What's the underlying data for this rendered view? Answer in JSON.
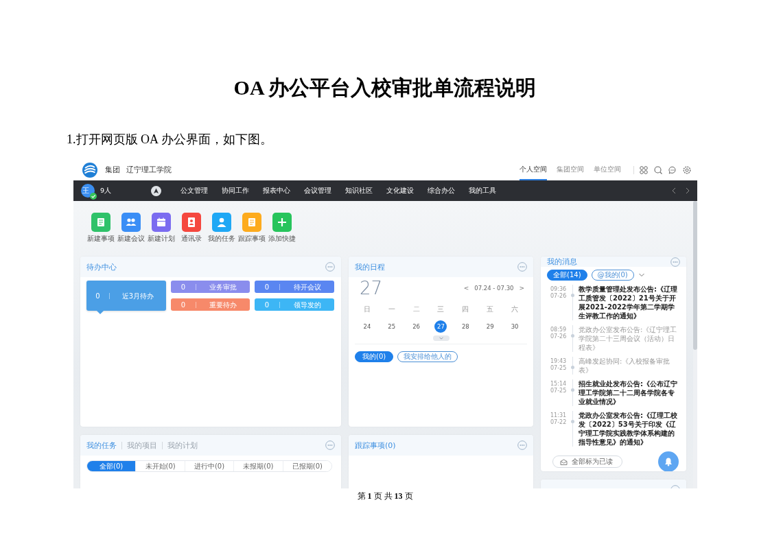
{
  "document": {
    "title": "OA 办公平台入校审批单流程说明",
    "step": "1.打开网页版 OA 办公界面，如下图。",
    "footer": "第 **1** 页 共 **13** 页"
  },
  "screen": {
    "header": {
      "org": "集团",
      "school": "辽宁理工学院",
      "spaces": [
        {
          "label": "个人空间",
          "selected": true
        },
        {
          "label": "集团空间",
          "selected": false
        },
        {
          "label": "单位空间",
          "selected": false
        }
      ]
    },
    "nav": {
      "avatar": "王",
      "online": true,
      "count": "9人",
      "items": [
        "公文管理",
        "协同工作",
        "报表中心",
        "会议管理",
        "知识社区",
        "文化建设",
        "综合办公",
        "我的工具"
      ]
    },
    "quick_actions": [
      {
        "label": "新建事项",
        "color": "#2fc26a"
      },
      {
        "label": "新建会议",
        "color": "#3a8ef6"
      },
      {
        "label": "新建计划",
        "color": "#7b6cf0"
      },
      {
        "label": "通讯录",
        "color": "#f5483f"
      },
      {
        "label": "我的任务",
        "color": "#1fa8f5"
      },
      {
        "label": "跟踪事项",
        "color": "#fdab1e"
      },
      {
        "label": "添加快捷",
        "color": "#27c45c"
      }
    ],
    "todo": {
      "title": "待办中心",
      "tiles": [
        {
          "count": "0",
          "label": "近3月待办",
          "color": "#4b9fe6",
          "selected": true
        },
        {
          "count": "0",
          "label": "业务审批",
          "color": "#8a8ded",
          "selected": false
        },
        {
          "count": "0",
          "label": "待开会议",
          "color": "#5a86f1",
          "selected": false
        },
        {
          "count": "0",
          "label": "重要待办",
          "color": "#f7896a",
          "selected": false
        },
        {
          "count": "0",
          "label": "领导发的",
          "color": "#3db6f5",
          "selected": false
        }
      ]
    },
    "calendar": {
      "title": "我的日程",
      "today": "27",
      "range": "07.24 - 07.30",
      "prev": "<",
      "next": ">",
      "weekdays": [
        "日",
        "一",
        "二",
        "三",
        "四",
        "五",
        "六"
      ],
      "days": [
        {
          "label": "24",
          "selected": false
        },
        {
          "label": "25",
          "selected": false
        },
        {
          "label": "26",
          "selected": false
        },
        {
          "label": "27",
          "selected": true
        },
        {
          "label": "28",
          "selected": false
        },
        {
          "label": "29",
          "selected": false
        },
        {
          "label": "30",
          "selected": false
        }
      ],
      "filters": [
        {
          "label": "我的(0)",
          "selected": true
        },
        {
          "label": "我安排给他人的",
          "selected": false
        }
      ]
    },
    "messages": {
      "title": "我的消息",
      "filters": [
        {
          "label": "全部(14)",
          "selected": true
        },
        {
          "label": "@我的(0)",
          "selected": false
        }
      ],
      "items": [
        {
          "time": "09:36",
          "date": "07-26",
          "text": "教学质量管理处发布公告:《辽理工质管发〔2022〕21号关于开展2021-2022学年第二学期学生评教工作的通知》",
          "read": false
        },
        {
          "time": "08:59",
          "date": "07-26",
          "text": "党政办公室发布公告:《辽宁理工学院第二十三周会议（活动）日程表》",
          "read": true
        },
        {
          "time": "19:43",
          "date": "07-25",
          "text": "高峰发起协同:《入校报备审批表》",
          "read": true
        },
        {
          "time": "15:14",
          "date": "07-25",
          "text": "招生就业处发布公告:《公布辽宁理工学院第二十二周各学院各专业就业情况》",
          "read": false
        },
        {
          "time": "11:31",
          "date": "07-22",
          "text": "党政办公室发布公告:《辽理工校发〔2022〕53号关于印发《辽宁理工学院实践教学体系构建的指导性意见》的通知》",
          "read": false
        }
      ],
      "mark_all": "全部标为已读"
    },
    "tasks": {
      "tabs": [
        {
          "label": "我的任务",
          "selected": true
        },
        {
          "label": "我的项目",
          "selected": false
        },
        {
          "label": "我的计划",
          "selected": false
        }
      ],
      "filters": [
        {
          "label": "全部(0)",
          "selected": true
        },
        {
          "label": "未开始(0)",
          "selected": false
        },
        {
          "label": "进行中(0)",
          "selected": false
        },
        {
          "label": "未报期(0)",
          "selected": false
        },
        {
          "label": "已报期(0)",
          "selected": false
        }
      ]
    },
    "tracking": {
      "title": "跟踪事项(0)"
    }
  }
}
